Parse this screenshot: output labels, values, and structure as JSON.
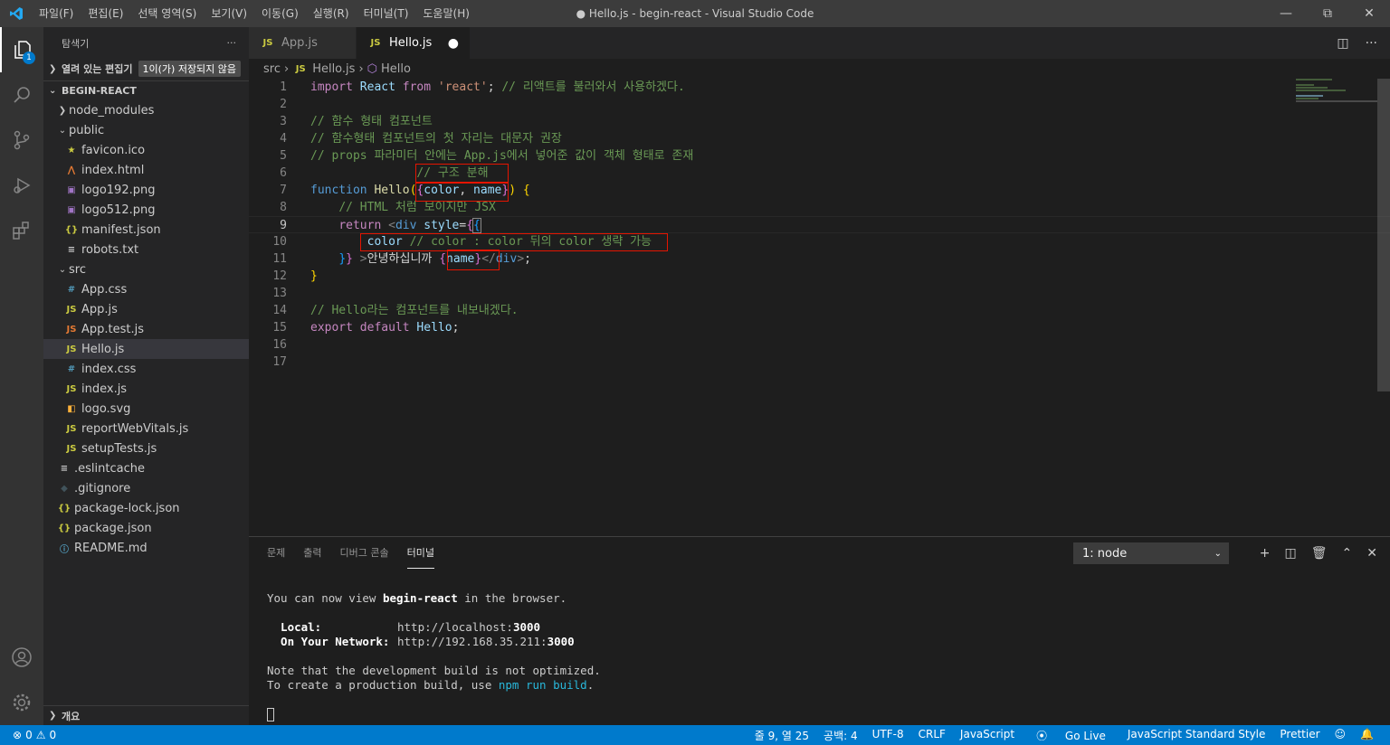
{
  "window": {
    "title": "● Hello.js - begin-react - Visual Studio Code",
    "menu": [
      "파일(F)",
      "편집(E)",
      "선택 영역(S)",
      "보기(V)",
      "이동(G)",
      "실행(R)",
      "터미널(T)",
      "도움말(H)"
    ]
  },
  "activity": {
    "explorer_badge": "1"
  },
  "sidebar": {
    "header": "탐색기",
    "more": "···",
    "open_editors": "열려 있는 편집기",
    "open_editors_badge": "1이(가) 저장되지 않음",
    "project": "BEGIN-REACT",
    "tree": [
      {
        "label": "node_modules",
        "icon": "chevron-right",
        "indent": 1
      },
      {
        "label": "public",
        "icon": "chevron-down",
        "indent": 1
      },
      {
        "label": "favicon.ico",
        "icon": "star-icon",
        "indent": 2
      },
      {
        "label": "index.html",
        "icon": "html-icon",
        "indent": 2
      },
      {
        "label": "logo192.png",
        "icon": "image-icon",
        "indent": 2
      },
      {
        "label": "logo512.png",
        "icon": "image-icon",
        "indent": 2
      },
      {
        "label": "manifest.json",
        "icon": "json-icon",
        "indent": 2
      },
      {
        "label": "robots.txt",
        "icon": "text-icon",
        "indent": 2
      },
      {
        "label": "src",
        "icon": "chevron-down",
        "indent": 1
      },
      {
        "label": "App.css",
        "icon": "css-icon",
        "indent": 2
      },
      {
        "label": "App.js",
        "icon": "js-icon",
        "indent": 2
      },
      {
        "label": "App.test.js",
        "icon": "test-js-icon",
        "indent": 2
      },
      {
        "label": "Hello.js",
        "icon": "js-icon",
        "indent": 2,
        "selected": true
      },
      {
        "label": "index.css",
        "icon": "css-icon",
        "indent": 2
      },
      {
        "label": "index.js",
        "icon": "js-icon",
        "indent": 2
      },
      {
        "label": "logo.svg",
        "icon": "svg-icon",
        "indent": 2
      },
      {
        "label": "reportWebVitals.js",
        "icon": "js-icon",
        "indent": 2
      },
      {
        "label": "setupTests.js",
        "icon": "js-icon",
        "indent": 2
      },
      {
        "label": ".eslintcache",
        "icon": "lines-icon",
        "indent": 1
      },
      {
        "label": ".gitignore",
        "icon": "git-icon",
        "indent": 1
      },
      {
        "label": "package-lock.json",
        "icon": "json-icon",
        "indent": 1
      },
      {
        "label": "package.json",
        "icon": "json-icon",
        "indent": 1
      },
      {
        "label": "README.md",
        "icon": "info-icon",
        "indent": 1
      }
    ],
    "outline": "개요"
  },
  "tabs": [
    {
      "label": "App.js",
      "active": false
    },
    {
      "label": "Hello.js",
      "active": true,
      "dirty": "●"
    }
  ],
  "breadcrumb": [
    "src",
    "Hello.js",
    "Hello"
  ],
  "code": {
    "line_numbers": [
      "1",
      "2",
      "3",
      "4",
      "5",
      "6",
      "7",
      "8",
      "9",
      "10",
      "11",
      "12",
      "13",
      "14",
      "15",
      "16",
      "17"
    ],
    "current_line": "9"
  },
  "panel": {
    "tabs": [
      "문제",
      "출력",
      "디버그 콘솔",
      "터미널"
    ],
    "active_tab": "터미널",
    "terminal_select": "1: node",
    "terminal": {
      "l1a": "You can now view ",
      "l1b": "begin-react",
      "l1c": " in the browser.",
      "local_label": "  Local:",
      "local_url_a": "http://localhost:",
      "local_url_b": "3000",
      "net_label": "  On Your Network:",
      "net_url_a": "http://192.168.35.211:",
      "net_url_b": "3000",
      "note1": "Note that the development build is not optimized.",
      "note2a": "To create a production build, use ",
      "note2b": "npm run build",
      "note2c": "."
    }
  },
  "status": {
    "errors": "0",
    "warnings": "0",
    "position": "줄 9, 열 25",
    "spaces": "공백: 4",
    "encoding": "UTF-8",
    "eol": "CRLF",
    "language": "JavaScript",
    "golive": "Go Live",
    "style": "JavaScript Standard Style",
    "formatter": "Prettier"
  },
  "colors": {
    "accent": "#007acc",
    "highlight_box": "#e51400"
  }
}
